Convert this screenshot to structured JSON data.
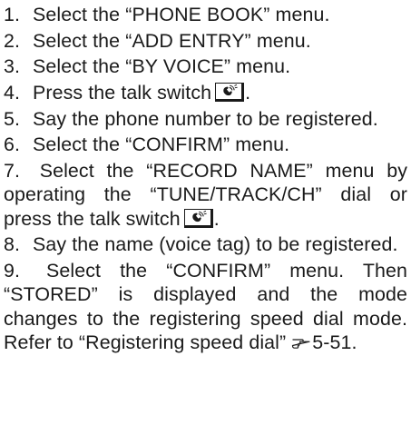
{
  "steps": [
    {
      "num": "1.",
      "text": "Select the “PHONE BOOK” menu."
    },
    {
      "num": "2.",
      "text": "Select the “ADD ENTRY” menu."
    },
    {
      "num": "3.",
      "text": "Select the “BY VOICE” menu."
    },
    {
      "num": "4.",
      "text_before": "Press the talk switch",
      "text_after": "."
    },
    {
      "num": "5.",
      "text": "Say the phone number to be registered."
    },
    {
      "num": "6.",
      "text": "Select the “CONFIRM” menu."
    },
    {
      "num": "7.",
      "text_before": "Select the “RECORD NAME” menu by operating the “TUNE/TRACK/CH” dial or press the talk switch",
      "text_after": "."
    },
    {
      "num": "8.",
      "text": "Say the name (voice tag) to be registered."
    },
    {
      "num": "9.",
      "text": "Select the “CONFIRM” menu. Then “STORED” is displayed and the mode changes to the registering speed dial mode. Refer to “Registering speed dial”",
      "ref": "5-51",
      "text_after": "."
    }
  ],
  "icons": {
    "talk_switch": "talk-switch-icon",
    "page_reference": "page-reference-hand-icon"
  }
}
